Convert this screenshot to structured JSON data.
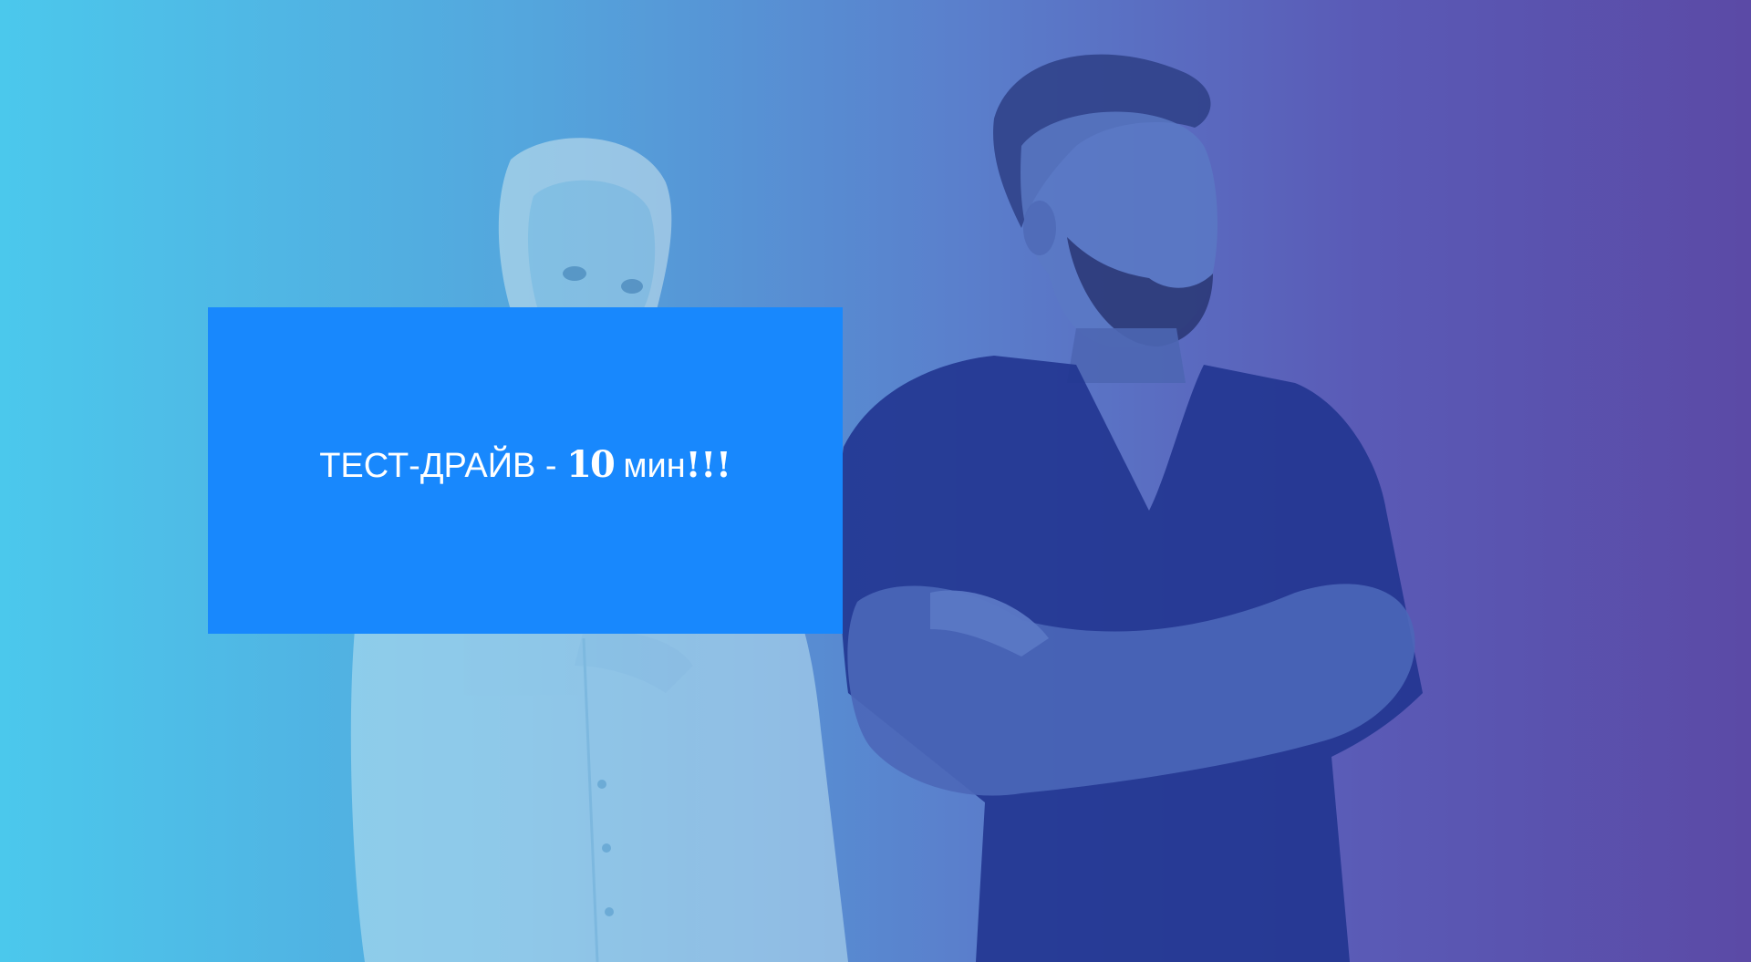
{
  "banner": {
    "text_main": "ТЕСТ-ДРАЙВ -",
    "text_number": "10",
    "text_unit": "мин",
    "text_exclaim": "!!!"
  },
  "colors": {
    "banner_bg": "#1888fd",
    "gradient_left": "#4bc8ec",
    "gradient_right": "#5b4aa6",
    "text": "#ffffff"
  }
}
